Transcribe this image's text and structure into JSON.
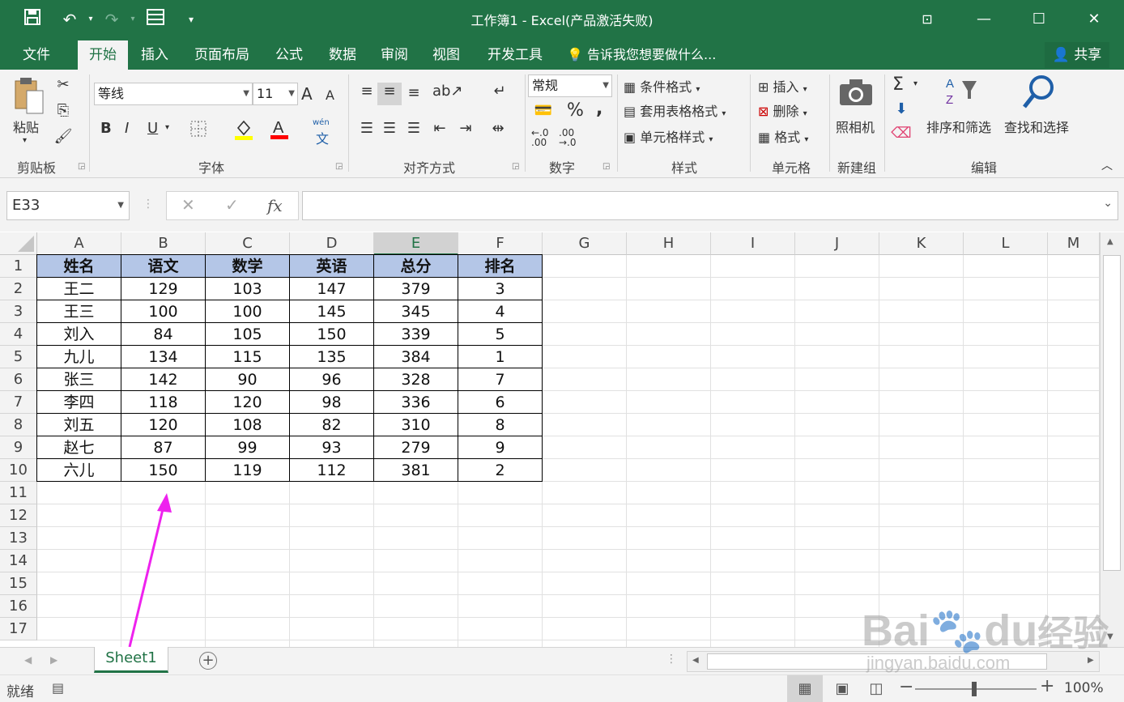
{
  "window": {
    "title": "工作簿1 - Excel(产品激活失败)",
    "minimize": "—",
    "restore": "☐",
    "close": "✕",
    "ribbon_display": "⊡"
  },
  "quick_access": {
    "save_icon": "save-icon",
    "undo_icon": "undo-icon",
    "redo_icon": "redo-icon",
    "form_icon": "form-icon",
    "customize_icon": "customize-icon"
  },
  "tabs": [
    "文件",
    "开始",
    "插入",
    "页面布局",
    "公式",
    "数据",
    "审阅",
    "视图",
    "开发工具"
  ],
  "active_tab": "开始",
  "tell_me": "告诉我您想要做什么...",
  "share": "共享",
  "ribbon": {
    "clipboard": {
      "label": "剪贴板",
      "paste": "粘贴"
    },
    "font": {
      "label": "字体",
      "font_name": "等线",
      "font_size": "11",
      "bold": "B",
      "italic": "I",
      "underline": "U",
      "grow": "A",
      "shrink": "A",
      "wen": "wén",
      "wen2": "文"
    },
    "alignment": {
      "label": "对齐方式"
    },
    "number": {
      "label": "数字",
      "format": "常规",
      "percent": "%",
      "comma": ",",
      "inc1": "←.0",
      "inc2": ".00",
      "dec1": ".00",
      "dec2": "→.0"
    },
    "styles": {
      "label": "样式",
      "conditional": "条件格式",
      "table": "套用表格格式",
      "cell_styles": "单元格样式"
    },
    "cells": {
      "label": "单元格",
      "insert": "插入",
      "delete": "删除",
      "format": "格式"
    },
    "camera": {
      "label": "新建组",
      "camera": "照相机"
    },
    "editing": {
      "label": "编辑",
      "sort": "排序和筛选",
      "find": "查找和选择",
      "sigma": "Σ"
    }
  },
  "formula_bar": {
    "name_box": "E33",
    "cancel": "✕",
    "enter": "✓",
    "fx": "fx",
    "value": ""
  },
  "columns": [
    "A",
    "B",
    "C",
    "D",
    "E",
    "F",
    "G",
    "H",
    "I",
    "J",
    "K",
    "L",
    "M"
  ],
  "selected_column": "E",
  "rows": [
    "1",
    "2",
    "3",
    "4",
    "5",
    "6",
    "7",
    "8",
    "9",
    "10",
    "11",
    "12",
    "13",
    "14",
    "15",
    "16",
    "17"
  ],
  "table": {
    "headers": [
      "姓名",
      "语文",
      "数学",
      "英语",
      "总分",
      "排名"
    ],
    "data": [
      [
        "王二",
        "129",
        "103",
        "147",
        "379",
        "3"
      ],
      [
        "王三",
        "100",
        "100",
        "145",
        "345",
        "4"
      ],
      [
        "刘入",
        "84",
        "105",
        "150",
        "339",
        "5"
      ],
      [
        "九儿",
        "134",
        "115",
        "135",
        "384",
        "1"
      ],
      [
        "张三",
        "142",
        "90",
        "96",
        "328",
        "7"
      ],
      [
        "李四",
        "118",
        "120",
        "98",
        "336",
        "6"
      ],
      [
        "刘五",
        "120",
        "108",
        "82",
        "310",
        "8"
      ],
      [
        "赵七",
        "87",
        "99",
        "93",
        "279",
        "9"
      ],
      [
        "六儿",
        "150",
        "119",
        "112",
        "381",
        "2"
      ]
    ]
  },
  "sheet_tabs": [
    "Sheet1"
  ],
  "add_sheet": "+",
  "status": {
    "ready": "就绪",
    "zoom": "100%",
    "zoom_minus": "−",
    "zoom_plus": "+"
  },
  "colors": {
    "excel_green": "#217346",
    "header_fill": "#b4c6e7",
    "arrow": "#ee22ee"
  },
  "watermark": {
    "brand": "Bai",
    "brand2": "du",
    "cn": "经验",
    "url": "jingyan.baidu.com"
  }
}
